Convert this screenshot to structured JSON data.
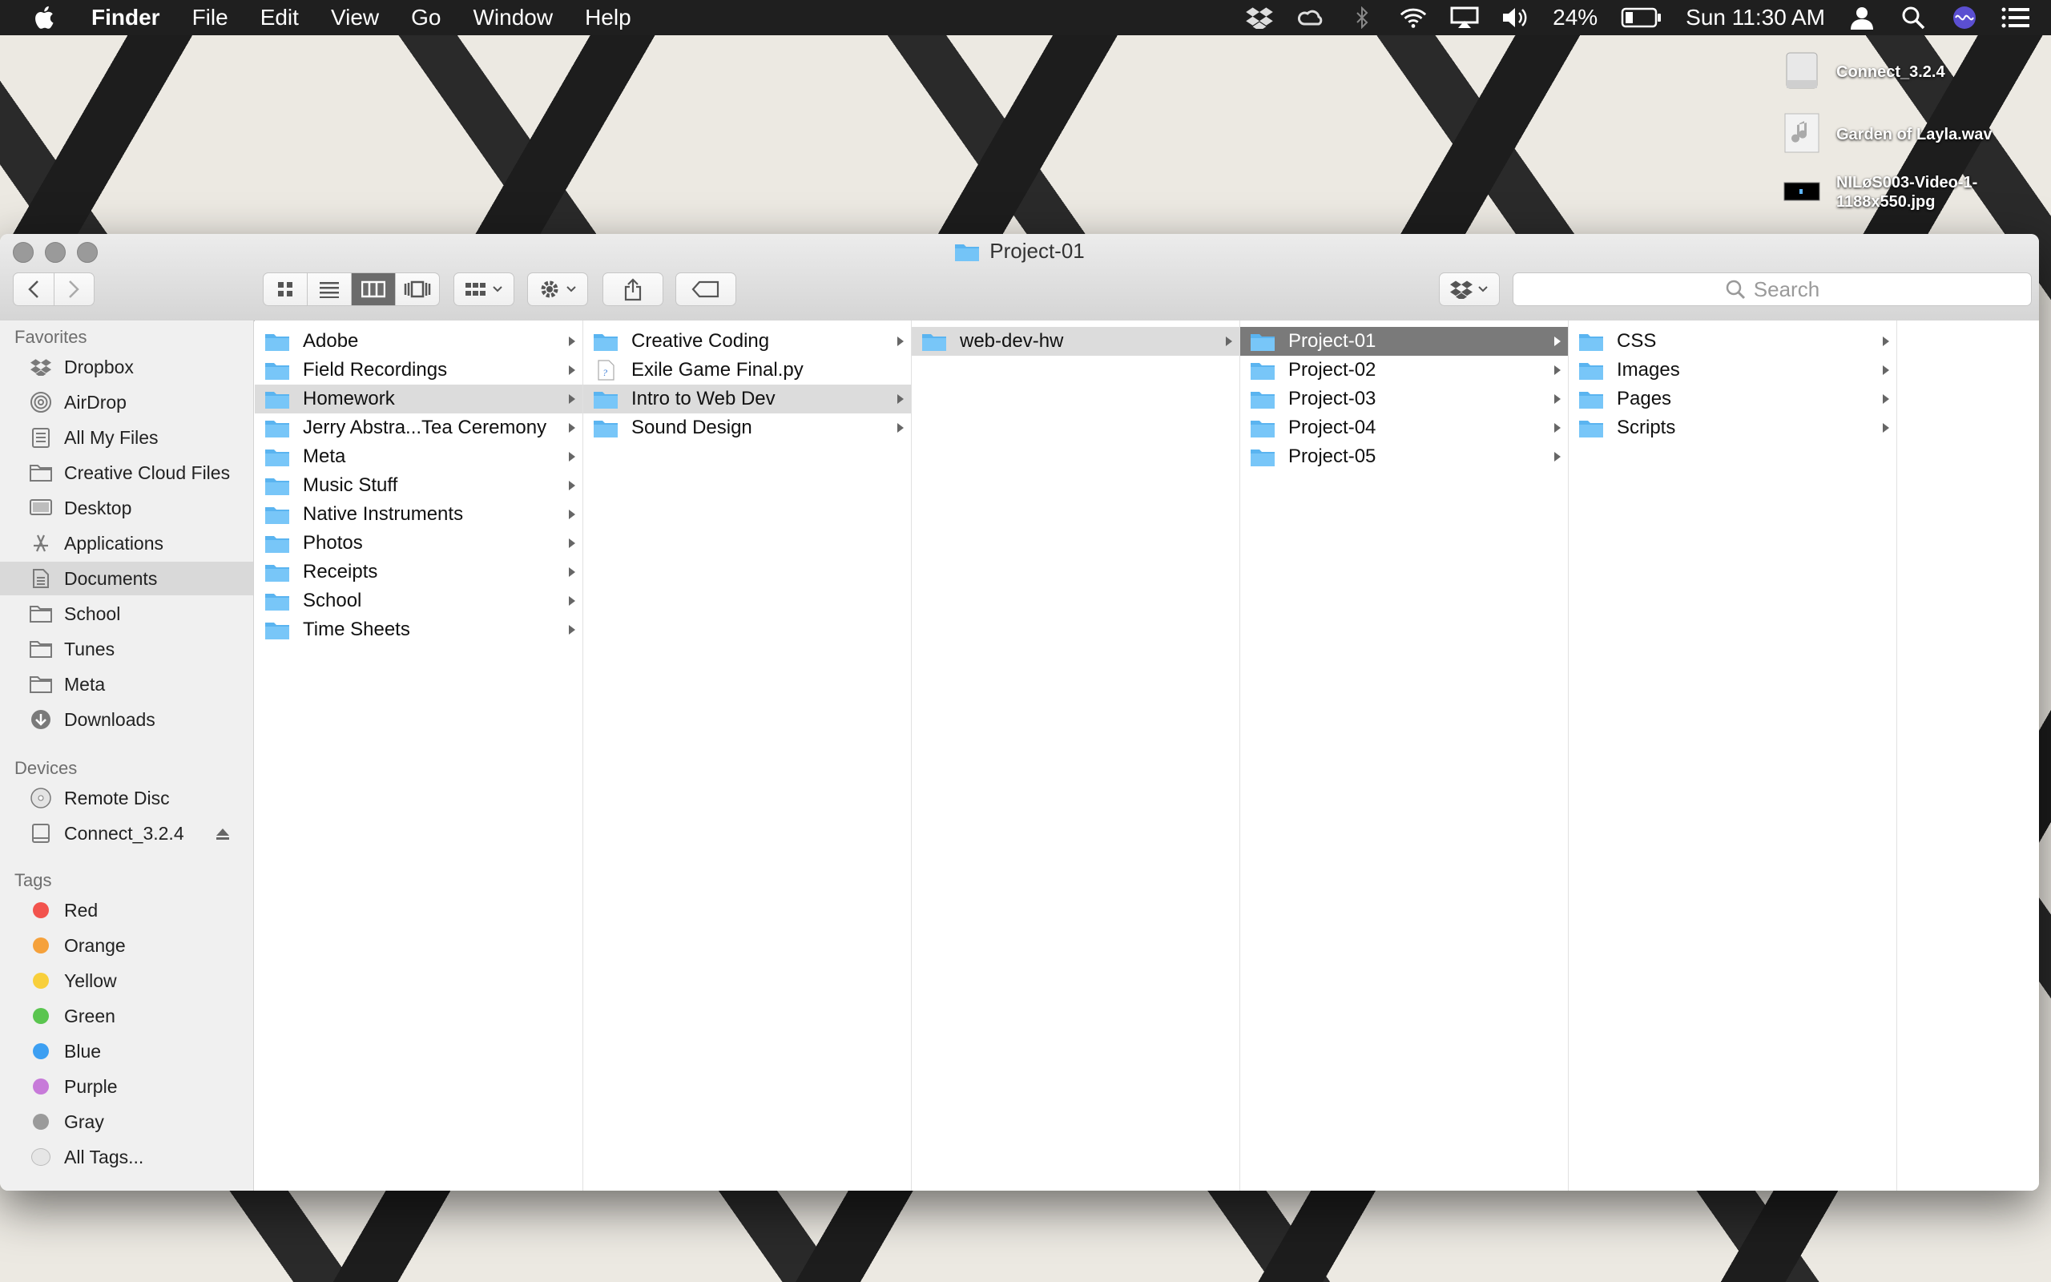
{
  "menubar": {
    "app_name": "Finder",
    "menus": [
      "File",
      "Edit",
      "View",
      "Go",
      "Window",
      "Help"
    ],
    "battery": "24%",
    "clock": "Sun 11:30 AM"
  },
  "desktop_items": [
    {
      "name": "Connect_3.2.4"
    },
    {
      "name": "Garden of Layla.wav"
    },
    {
      "name": "NILøS003-Video-1-1188x550.jpg"
    }
  ],
  "window": {
    "title": "Project-01",
    "search_placeholder": "Search"
  },
  "sidebar": {
    "favorites_header": "Favorites",
    "favorites": [
      {
        "label": "Dropbox",
        "icon": "dropbox-icon"
      },
      {
        "label": "AirDrop",
        "icon": "airdrop-icon"
      },
      {
        "label": "All My Files",
        "icon": "all-files-icon"
      },
      {
        "label": "Creative Cloud Files",
        "icon": "folder-icon"
      },
      {
        "label": "Desktop",
        "icon": "desktop-icon"
      },
      {
        "label": "Applications",
        "icon": "applications-icon"
      },
      {
        "label": "Documents",
        "icon": "documents-icon",
        "selected": true
      },
      {
        "label": "School",
        "icon": "folder-icon"
      },
      {
        "label": "Tunes",
        "icon": "folder-icon"
      },
      {
        "label": "Meta",
        "icon": "folder-icon"
      },
      {
        "label": "Downloads",
        "icon": "downloads-icon"
      }
    ],
    "devices_header": "Devices",
    "devices": [
      {
        "label": "Remote Disc",
        "icon": "disc-icon"
      },
      {
        "label": "Connect_3.2.4",
        "icon": "drive-icon"
      }
    ],
    "tags_header": "Tags",
    "tags": [
      {
        "label": "Red",
        "color": "#f2534d"
      },
      {
        "label": "Orange",
        "color": "#f5a13b"
      },
      {
        "label": "Yellow",
        "color": "#f8cf3b"
      },
      {
        "label": "Green",
        "color": "#5ac54f"
      },
      {
        "label": "Blue",
        "color": "#3c9ff2"
      },
      {
        "label": "Purple",
        "color": "#c77ad9"
      },
      {
        "label": "Gray",
        "color": "#9a9a9a"
      },
      {
        "label": "All Tags...",
        "color": ""
      }
    ]
  },
  "columns": [
    {
      "items": [
        {
          "label": "Adobe",
          "type": "folder"
        },
        {
          "label": "Field Recordings",
          "type": "folder"
        },
        {
          "label": "Homework",
          "type": "folder",
          "state": "path"
        },
        {
          "label": "Jerry Abstra...Tea Ceremony",
          "type": "folder"
        },
        {
          "label": "Meta",
          "type": "folder"
        },
        {
          "label": "Music Stuff",
          "type": "folder"
        },
        {
          "label": "Native Instruments",
          "type": "folder"
        },
        {
          "label": "Photos",
          "type": "folder"
        },
        {
          "label": "Receipts",
          "type": "folder"
        },
        {
          "label": "School",
          "type": "folder"
        },
        {
          "label": "Time Sheets",
          "type": "folder"
        }
      ]
    },
    {
      "items": [
        {
          "label": "Creative Coding",
          "type": "folder"
        },
        {
          "label": "Exile Game Final.py",
          "type": "file"
        },
        {
          "label": "Intro to Web Dev",
          "type": "folder",
          "state": "path"
        },
        {
          "label": "Sound Design",
          "type": "folder"
        }
      ]
    },
    {
      "items": [
        {
          "label": "web-dev-hw",
          "type": "folder",
          "state": "path"
        }
      ]
    },
    {
      "items": [
        {
          "label": "Project-01",
          "type": "folder",
          "state": "selected"
        },
        {
          "label": "Project-02",
          "type": "folder"
        },
        {
          "label": "Project-03",
          "type": "folder"
        },
        {
          "label": "Project-04",
          "type": "folder"
        },
        {
          "label": "Project-05",
          "type": "folder"
        }
      ]
    },
    {
      "items": [
        {
          "label": "CSS",
          "type": "folder"
        },
        {
          "label": "Images",
          "type": "folder"
        },
        {
          "label": "Pages",
          "type": "folder"
        },
        {
          "label": "Scripts",
          "type": "folder"
        }
      ]
    }
  ]
}
